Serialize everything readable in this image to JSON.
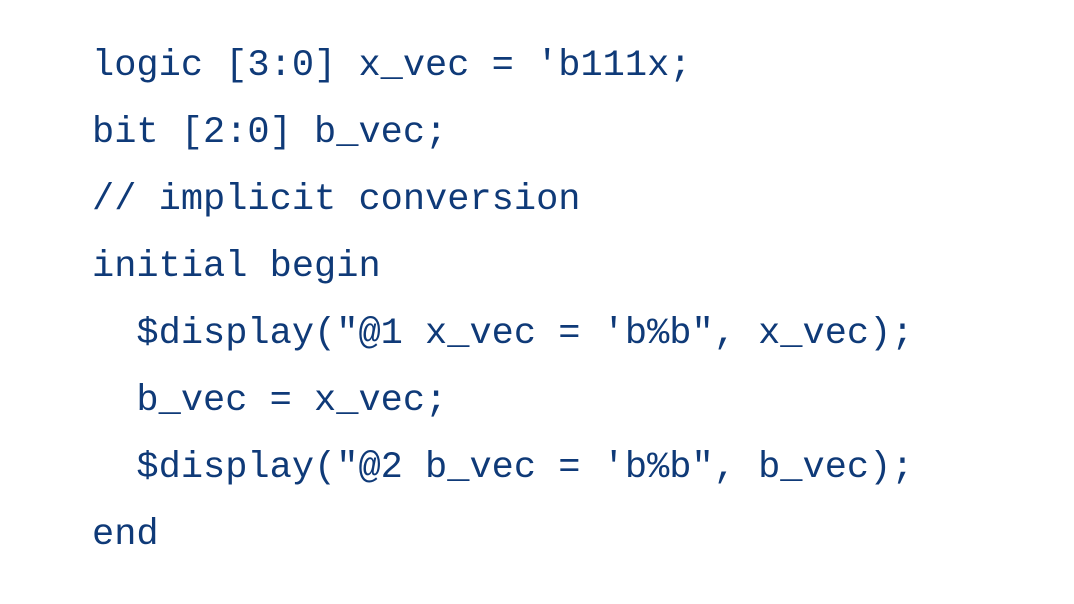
{
  "code": {
    "lines": [
      "logic [3:0] x_vec = 'b111x;",
      "bit [2:0] b_vec;",
      "// implicit conversion",
      "initial begin",
      "  $display(\"@1 x_vec = 'b%b\", x_vec);",
      "  b_vec = x_vec;",
      "  $display(\"@2 b_vec = 'b%b\", b_vec);",
      "end"
    ],
    "text_color": "#0f3a78"
  }
}
